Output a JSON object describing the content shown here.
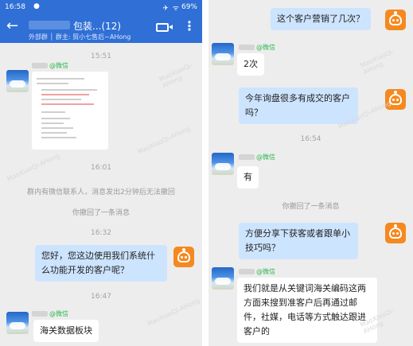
{
  "left": {
    "status_bar": {
      "time": "16:58",
      "dot": "●",
      "signal_icons": "✈ ᯤ",
      "battery": "69%"
    },
    "header": {
      "title": "包装...(12)",
      "subtitle": "外部群 │ 群主: 贸小七售后~AHong"
    },
    "messages": [
      {
        "type": "timestamp",
        "text": "15:51"
      },
      {
        "type": "incoming-image",
        "sender_suffix": "@微信"
      },
      {
        "type": "timestamp",
        "text": "16:01"
      },
      {
        "type": "system",
        "text": "群内有微信联系人，消息发出2分钟后无法撤回"
      },
      {
        "type": "system",
        "text": "你撤回了一条消息"
      },
      {
        "type": "timestamp",
        "text": "16:32"
      },
      {
        "type": "outgoing",
        "text": "您好，您这边使用我们系统什么功能开发的客户呢？"
      },
      {
        "type": "timestamp",
        "text": "16:47"
      },
      {
        "type": "incoming",
        "sender_suffix": "@微信",
        "text": "海关数据板块"
      }
    ]
  },
  "right": {
    "messages": [
      {
        "type": "outgoing",
        "text": "这个客户营销了几次？"
      },
      {
        "type": "incoming",
        "sender_suffix": "@微信",
        "text": "2次"
      },
      {
        "type": "outgoing",
        "text": "今年询盘很多有成交的客户吗？"
      },
      {
        "type": "timestamp",
        "text": "16:54"
      },
      {
        "type": "incoming",
        "sender_suffix": "@微信",
        "text": "有"
      },
      {
        "type": "system",
        "text": "你撤回了一条消息"
      },
      {
        "type": "outgoing",
        "text": "方便分享下获客或者跟单小技巧吗？"
      },
      {
        "type": "incoming",
        "sender_suffix": "@微信",
        "text": "我们就是从关键词海关编码这两方面来搜到准客户后再通过邮件，社媒，电话等方式触达跟进客户的"
      }
    ]
  },
  "watermark": "MaoXiaoQi-AHong",
  "colors": {
    "header": "#2f6fd6",
    "outgoing_bubble": "#cde4ff",
    "bot_avatar": "#f5891f",
    "wechat_tag": "#2eb84f"
  }
}
